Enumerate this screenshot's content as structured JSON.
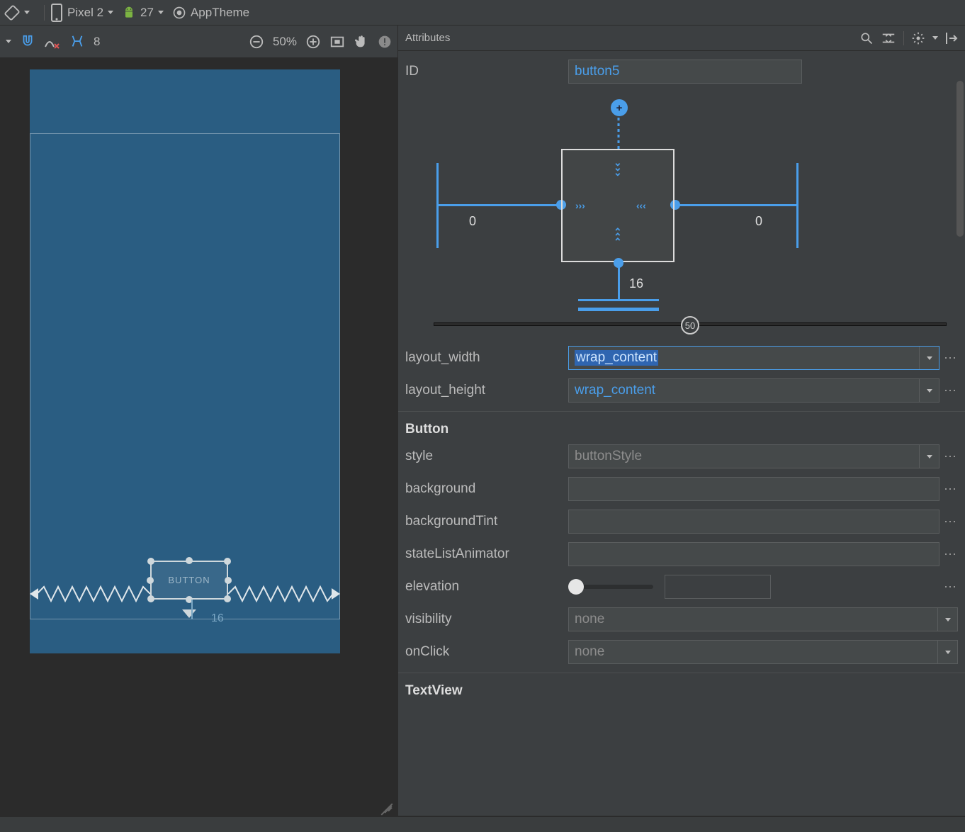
{
  "top": {
    "device": "Pixel 2",
    "api": "27",
    "theme": "AppTheme"
  },
  "leftToolbar": {
    "layer": "8",
    "zoom": "50%"
  },
  "canvas": {
    "button_label": "BUTTON",
    "margin_bottom": "16"
  },
  "panel_title": "Attributes",
  "id_label": "ID",
  "id_value": "button5",
  "constraints": {
    "left": "0",
    "right": "0",
    "bottom": "16",
    "bias": "50"
  },
  "layout_width_label": "layout_width",
  "layout_width": "wrap_content",
  "layout_height_label": "layout_height",
  "layout_height": "wrap_content",
  "section_button": "Button",
  "attrs": {
    "style_label": "style",
    "style": "buttonStyle",
    "background_label": "background",
    "backgroundTint_label": "backgroundTint",
    "stateListAnimator_label": "stateListAnimator",
    "elevation_label": "elevation",
    "visibility_label": "visibility",
    "visibility": "none",
    "onClick_label": "onClick",
    "onClick": "none"
  },
  "section_textview": "TextView"
}
